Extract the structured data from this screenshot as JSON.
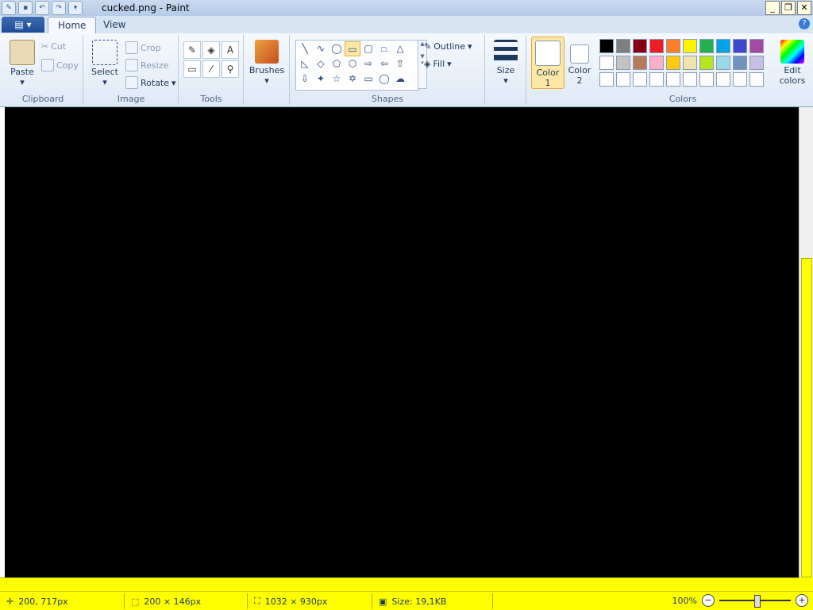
{
  "window": {
    "title": "cucked.png - Paint",
    "controls": [
      "_",
      "❐",
      "✕"
    ]
  },
  "tabs": [
    {
      "label": "Home"
    },
    {
      "label": "View"
    }
  ],
  "ribbon": {
    "clipboard": {
      "label": "Clipboard",
      "paste": "Paste",
      "cut": "Cut",
      "copy": "Copy"
    },
    "image": {
      "label": "Image",
      "select": "Select",
      "crop": "Crop",
      "resize": "Resize",
      "rotate": "Rotate"
    },
    "tools": {
      "label": "Tools"
    },
    "brushes": {
      "label": "Brushes"
    },
    "shapes": {
      "label": "Shapes",
      "outline": "Outline",
      "fill": "Fill"
    },
    "size": {
      "label": "Size"
    },
    "color1": {
      "line1": "Color",
      "line2": "1"
    },
    "color2": {
      "line1": "Color",
      "line2": "2"
    },
    "colors": {
      "label": "Colors",
      "edit_line1": "Edit",
      "edit_line2": "colors"
    }
  },
  "palette": [
    "#000000",
    "#7f7f7f",
    "#880015",
    "#ed1c24",
    "#ff7f27",
    "#fff200",
    "#22b14c",
    "#00a2e8",
    "#3f48cc",
    "#a349a4",
    "#ffffff",
    "#c3c3c3",
    "#b97a57",
    "#ffaec9",
    "#ffc90e",
    "#efe4b0",
    "#b5e61d",
    "#99d9ea",
    "#7092be",
    "#c8bfe7",
    "#ffffff",
    "#ffffff",
    "#ffffff",
    "#ffffff",
    "#ffffff",
    "#ffffff",
    "#ffffff",
    "#ffffff",
    "#ffffff",
    "#ffffff"
  ],
  "status": {
    "cursor_pos": "200, 717px",
    "selection_size": "200 × 146px",
    "image_size": "1032 × 930px",
    "file_size": "Size: 19,1KB",
    "zoom": "100%"
  }
}
